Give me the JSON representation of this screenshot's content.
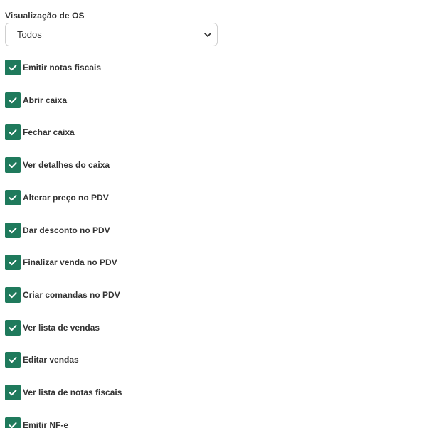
{
  "os_view": {
    "label": "Visualização de OS",
    "selected": "Todos",
    "dropdown_icon": "chevron-down-icon"
  },
  "permissions": [
    {
      "label": "Emitir notas fiscais",
      "checked": true
    },
    {
      "label": "Abrir caixa",
      "checked": true
    },
    {
      "label": "Fechar caixa",
      "checked": true
    },
    {
      "label": "Ver detalhes do caixa",
      "checked": true
    },
    {
      "label": "Alterar preço no PDV",
      "checked": true
    },
    {
      "label": "Dar desconto no PDV",
      "checked": true
    },
    {
      "label": "Finalizar venda no PDV",
      "checked": true
    },
    {
      "label": "Criar comandas no PDV",
      "checked": true
    },
    {
      "label": "Ver lista de vendas",
      "checked": true
    },
    {
      "label": "Editar vendas",
      "checked": true
    },
    {
      "label": "Ver lista de notas fiscais",
      "checked": true
    },
    {
      "label": "Emitir NF-e",
      "checked": true
    }
  ],
  "colors": {
    "checkbox_fill": "#1f7a5c",
    "text": "#333333",
    "border": "#cfcfcf"
  }
}
